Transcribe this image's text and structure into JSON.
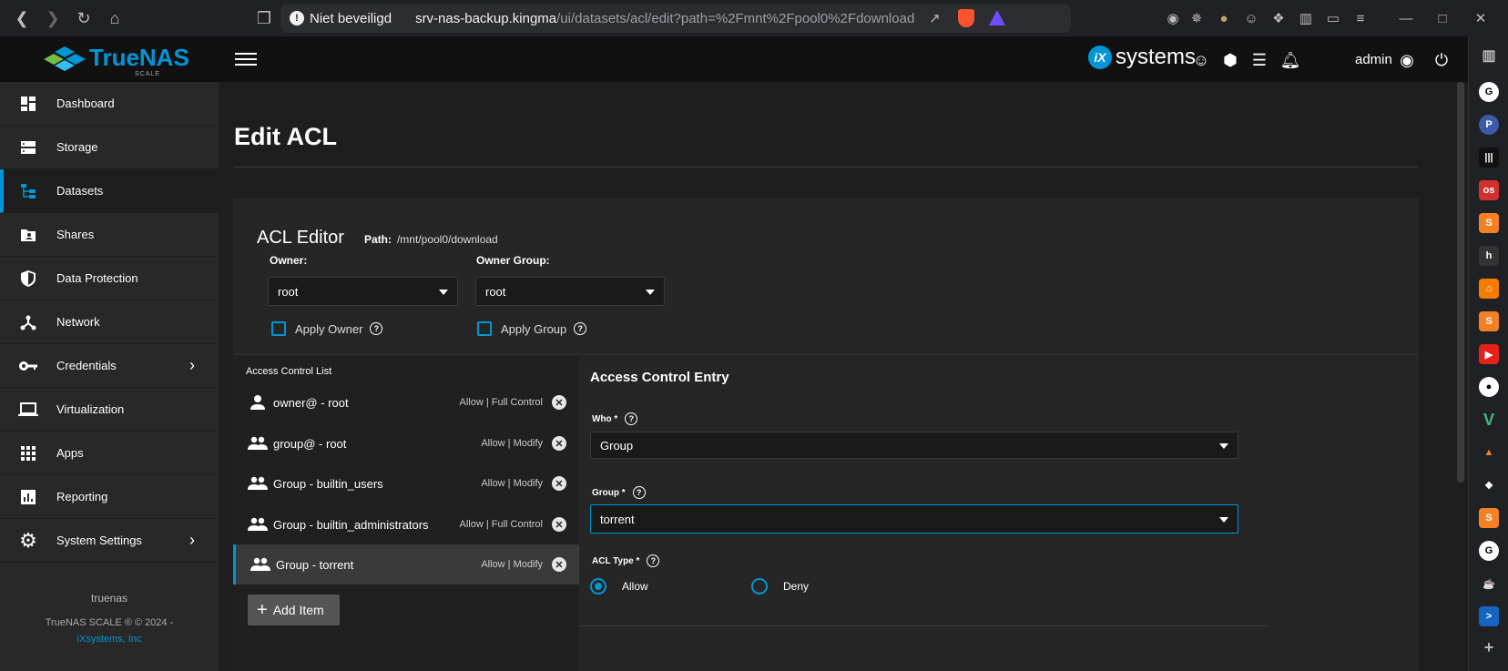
{
  "browser": {
    "security_label": "Niet beveiligd",
    "url_host": "srv-nas-backup.kingma",
    "url_rest": "/ui/datasets/acl/edit?path=%2Fmnt%2Fpool0%2Fdownload"
  },
  "header": {
    "logo_text": "TrueNAS",
    "logo_sub": "SCALE",
    "vendor_logo": "systems",
    "vendor_logo_mark": "iX",
    "user": "admin"
  },
  "sidebar": {
    "items": [
      {
        "label": "Dashboard",
        "icon": "dashboard-icon"
      },
      {
        "label": "Storage",
        "icon": "storage-icon"
      },
      {
        "label": "Datasets",
        "icon": "datasets-icon",
        "active": true
      },
      {
        "label": "Shares",
        "icon": "shares-icon"
      },
      {
        "label": "Data Protection",
        "icon": "shield-icon"
      },
      {
        "label": "Network",
        "icon": "network-icon"
      },
      {
        "label": "Credentials",
        "icon": "key-icon",
        "has_children": true
      },
      {
        "label": "Virtualization",
        "icon": "laptop-icon"
      },
      {
        "label": "Apps",
        "icon": "apps-icon"
      },
      {
        "label": "Reporting",
        "icon": "reporting-icon"
      },
      {
        "label": "System Settings",
        "icon": "gear-icon",
        "has_children": true
      }
    ],
    "footer": {
      "hostname": "truenas",
      "copyright": "TrueNAS SCALE ® © 2024 -",
      "company": "iXsystems, Inc"
    }
  },
  "page": {
    "title": "Edit ACL"
  },
  "acl_editor": {
    "title": "ACL Editor",
    "path_label": "Path:",
    "path_value": "/mnt/pool0/download",
    "owner_label": "Owner:",
    "owner_value": "root",
    "owner_group_label": "Owner Group:",
    "owner_group_value": "root",
    "apply_owner_label": "Apply Owner",
    "apply_group_label": "Apply Group",
    "apply_owner_checked": false,
    "apply_group_checked": false
  },
  "acl_list": {
    "header": "Access Control List",
    "entries": [
      {
        "label": "owner@ - root",
        "perm": "Allow | Full Control",
        "icon": "person-icon"
      },
      {
        "label": "group@ - root",
        "perm": "Allow | Modify",
        "icon": "group-icon"
      },
      {
        "label": "Group - builtin_users",
        "perm": "Allow | Modify",
        "icon": "group-icon"
      },
      {
        "label": "Group - builtin_administrators",
        "perm": "Allow | Full Control",
        "icon": "group-icon"
      },
      {
        "label": "Group - torrent",
        "perm": "Allow | Modify",
        "icon": "group-icon",
        "selected": true
      }
    ],
    "add_item_label": "Add Item"
  },
  "entry": {
    "title": "Access Control Entry",
    "who_label": "Who *",
    "who_value": "Group",
    "group_label": "Group *",
    "group_value": "torrent",
    "acl_type_label": "ACL Type *",
    "acl_type_options": [
      "Allow",
      "Deny"
    ],
    "acl_type_selected": "Allow"
  },
  "colors": {
    "accent": "#0095d5",
    "background": "#1e1e1e",
    "card": "#262626",
    "sidebar": "#282828"
  }
}
